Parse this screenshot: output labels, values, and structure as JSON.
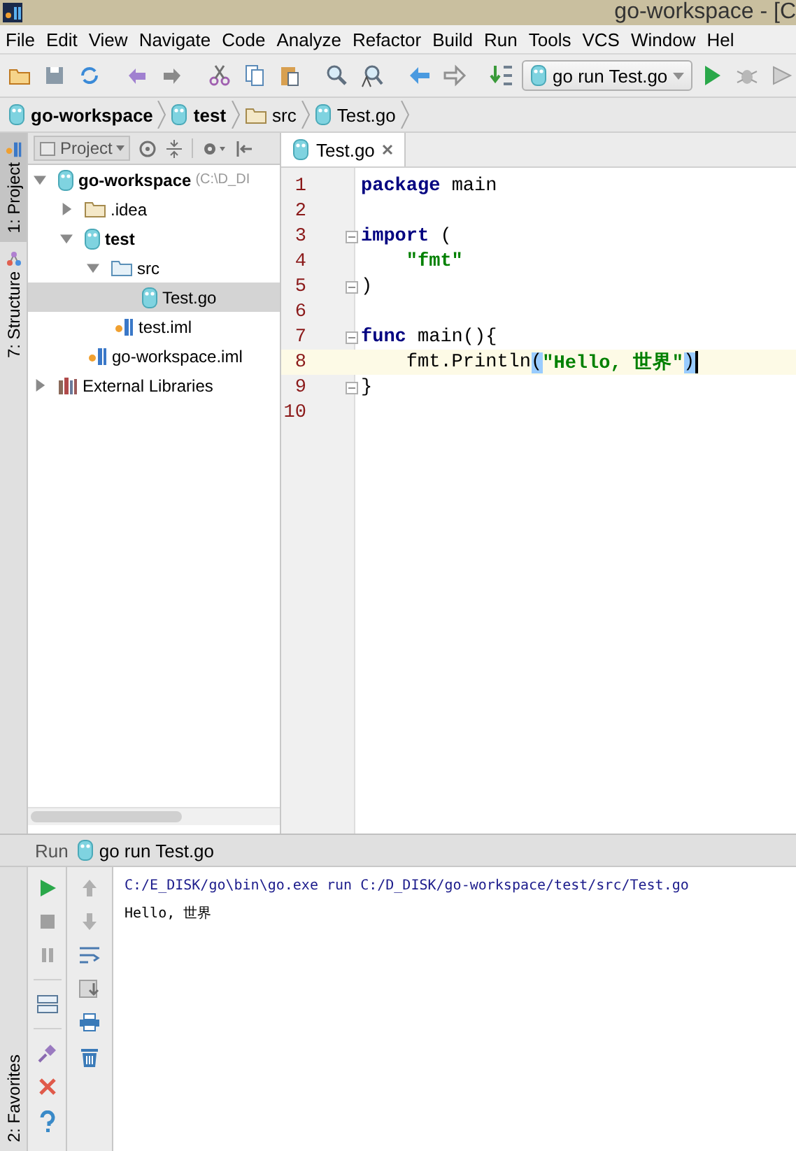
{
  "window": {
    "title": "go-workspace - [C"
  },
  "menu": [
    "File",
    "Edit",
    "View",
    "Navigate",
    "Code",
    "Analyze",
    "Refactor",
    "Build",
    "Run",
    "Tools",
    "VCS",
    "Window",
    "Hel"
  ],
  "toolbar": {
    "run_config": "go run Test.go"
  },
  "breadcrumb": [
    {
      "label": "go-workspace",
      "kind": "module",
      "bold": true
    },
    {
      "label": "test",
      "kind": "module",
      "bold": true
    },
    {
      "label": "src",
      "kind": "folder",
      "bold": false
    },
    {
      "label": "Test.go",
      "kind": "gofile",
      "bold": false
    }
  ],
  "side_tabs": [
    {
      "label": "1: Project",
      "selected": true
    },
    {
      "label": "7: Structure",
      "selected": false
    }
  ],
  "bottom_side_tabs": [
    {
      "label": "2: Favorites",
      "selected": false
    }
  ],
  "project": {
    "title": "Project",
    "tree": [
      {
        "label": "go-workspace",
        "hint": "(C:\\D_DI",
        "kind": "module",
        "bold": true,
        "expanded": true,
        "selected": false,
        "children": [
          {
            "label": ".idea",
            "kind": "folder",
            "bold": false,
            "expanded": false,
            "selected": false
          },
          {
            "label": "test",
            "kind": "module",
            "bold": true,
            "expanded": true,
            "selected": false,
            "children": [
              {
                "label": "src",
                "kind": "srcfolder",
                "bold": false,
                "expanded": true,
                "selected": false,
                "children": [
                  {
                    "label": "Test.go",
                    "kind": "gofile",
                    "bold": false,
                    "selected": true
                  }
                ]
              },
              {
                "label": "test.iml",
                "kind": "iml",
                "bold": false,
                "selected": false
              }
            ]
          },
          {
            "label": "go-workspace.iml",
            "kind": "iml",
            "bold": false,
            "selected": false
          }
        ]
      },
      {
        "label": "External Libraries",
        "kind": "library",
        "bold": false,
        "expanded": false,
        "selected": false
      }
    ]
  },
  "editor": {
    "tabs": [
      {
        "label": "Test.go",
        "selected": true
      }
    ],
    "lines": [
      {
        "number": "1",
        "current": false,
        "fold": false,
        "tokens": [
          {
            "kind": "keyword",
            "text": "package"
          },
          {
            "kind": "plain",
            "text": " main"
          }
        ]
      },
      {
        "number": "2",
        "current": false,
        "fold": false
      },
      {
        "number": "3",
        "current": false,
        "fold": true,
        "tokens": [
          {
            "kind": "keyword",
            "text": "import"
          },
          {
            "kind": "plain",
            "text": " ("
          }
        ]
      },
      {
        "number": "4",
        "current": false,
        "fold": false,
        "indented": true,
        "tokens": [
          {
            "kind": "string",
            "text": "\"fmt\""
          }
        ]
      },
      {
        "number": "5",
        "current": false,
        "fold": true,
        "tokens": [
          {
            "kind": "plain",
            "text": ")"
          }
        ]
      },
      {
        "number": "6",
        "current": false,
        "fold": false
      },
      {
        "number": "7",
        "current": false,
        "fold": true,
        "tokens": [
          {
            "kind": "keyword",
            "text": "func"
          },
          {
            "kind": "plain",
            "text": " main(){"
          }
        ]
      },
      {
        "number": "8",
        "current": true,
        "fold": false,
        "indented": true,
        "tokens": [
          {
            "kind": "plain",
            "text": "fmt.Println"
          },
          {
            "kind": "brace",
            "text": "("
          },
          {
            "kind": "string",
            "text": "\"Hello, 世界\""
          },
          {
            "kind": "brace",
            "text": ")"
          }
        ]
      },
      {
        "number": "9",
        "current": false,
        "fold": true,
        "tokens": [
          {
            "kind": "plain",
            "text": "}"
          }
        ]
      },
      {
        "number": "10",
        "current": false,
        "fold": false
      }
    ]
  },
  "run": {
    "title": "Run",
    "config": "go run Test.go",
    "output": [
      {
        "kind": "command",
        "text": "C:/E_DISK/go\\bin\\go.exe run C:/D_DISK/go-workspace/test/src/Test.go"
      },
      {
        "kind": "stdout",
        "text": "Hello, 世界"
      }
    ]
  }
}
